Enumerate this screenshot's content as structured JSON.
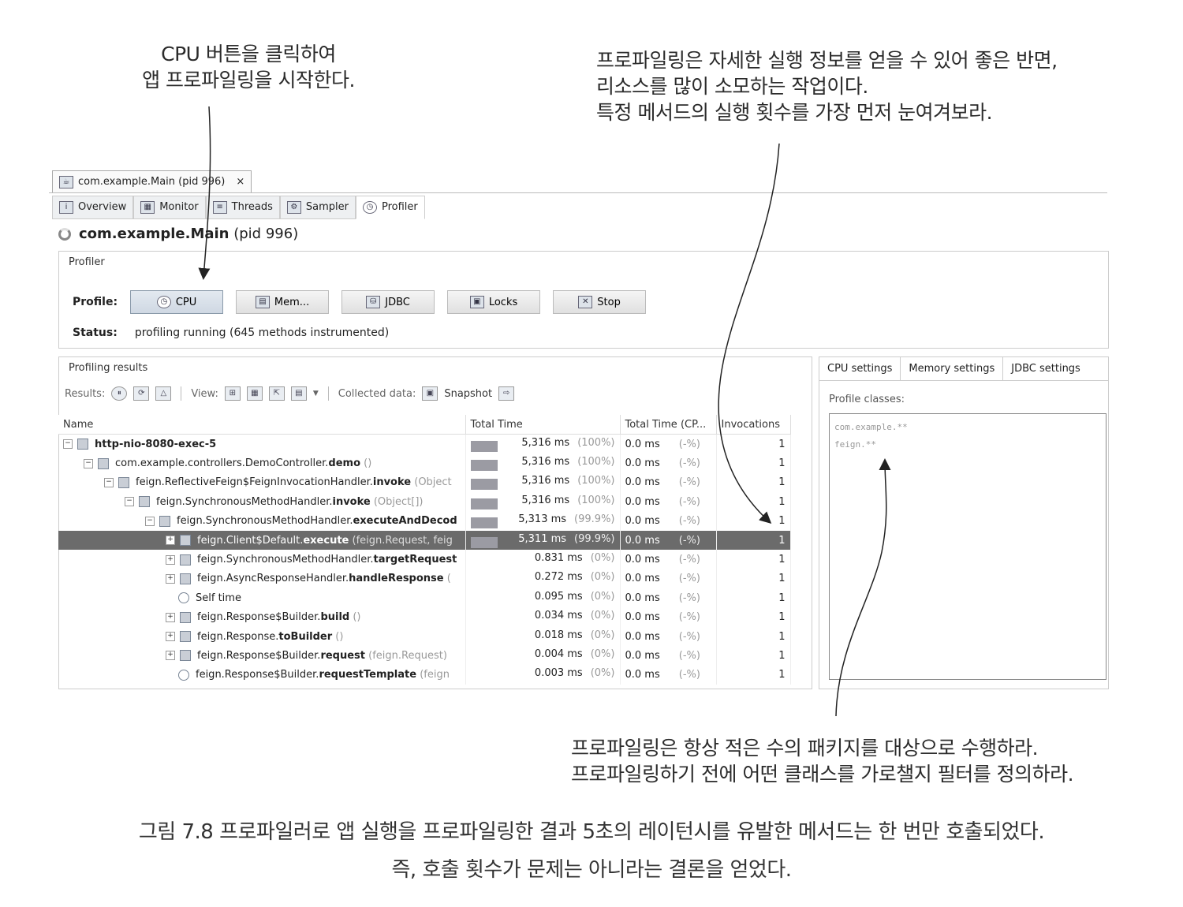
{
  "annotations": {
    "top_left": [
      "CPU 버튼을 클릭하여",
      "앱 프로파일링을 시작한다."
    ],
    "top_right": [
      "프로파일링은 자세한 실행 정보를 얻을 수 있어 좋은 반면,",
      "리소스를 많이 소모하는 작업이다.",
      "특정 메서드의 실행 횟수를 가장 먼저 눈여겨보라."
    ],
    "bottom_right": [
      "프로파일링은 항상 적은 수의 패키지를 대상으로 수행하라.",
      "프로파일링하기 전에 어떤 클래스를 가로챌지 필터를 정의하라."
    ]
  },
  "caption": [
    "그림 7.8 프로파일러로 앱 실행을 프로파일링한 결과 5초의 레이턴시를 유발한 메서드는 한 번만 호출되었다.",
    "즉, 호출 횟수가 문제는 아니라는 결론을 얻었다."
  ],
  "window_tab": {
    "label": "com.example.Main (pid 996)",
    "close": "×"
  },
  "subtabs": [
    "Overview",
    "Monitor",
    "Threads",
    "Sampler",
    "Profiler"
  ],
  "title": {
    "main": "com.example.Main",
    "pid": "(pid 996)"
  },
  "profiler": {
    "section_title": "Profiler",
    "profile_label": "Profile:",
    "buttons": [
      "CPU",
      "Mem...",
      "JDBC",
      "Locks",
      "Stop"
    ],
    "status_label": "Status:",
    "status_value": "profiling running (645 methods instrumented)"
  },
  "results": {
    "section_title": "Profiling results",
    "results_label": "Results:",
    "view_label": "View:",
    "collected_label": "Collected data:",
    "snapshot_label": "Snapshot",
    "columns": [
      "Name",
      "Total Time",
      "Total Time (CP...",
      "Invocations"
    ],
    "rows": [
      {
        "name": "http-nio-8080-exec-5",
        "method": "",
        "args": "",
        "total": "5,316 ms",
        "total_pct": "(100%)",
        "cpu": "0.0 ms",
        "cpu_pct": "(-%)",
        "inv": "1"
      },
      {
        "name": "com.example.controllers.DemoController.",
        "method": "demo",
        "args": " ()",
        "total": "5,316 ms",
        "total_pct": "(100%)",
        "cpu": "0.0 ms",
        "cpu_pct": "(-%)",
        "inv": "1"
      },
      {
        "name": "feign.ReflectiveFeign$FeignInvocationHandler.",
        "method": "invoke",
        "args": " (Object",
        "total": "5,316 ms",
        "total_pct": "(100%)",
        "cpu": "0.0 ms",
        "cpu_pct": "(-%)",
        "inv": "1"
      },
      {
        "name": "feign.SynchronousMethodHandler.",
        "method": "invoke",
        "args": " (Object[])",
        "total": "5,316 ms",
        "total_pct": "(100%)",
        "cpu": "0.0 ms",
        "cpu_pct": "(-%)",
        "inv": "1"
      },
      {
        "name": "feign.SynchronousMethodHandler.",
        "method": "executeAndDecod",
        "args": "",
        "total": "5,313 ms",
        "total_pct": "(99.9%)",
        "cpu": "0.0 ms",
        "cpu_pct": "(-%)",
        "inv": "1"
      },
      {
        "name": "feign.Client$Default.",
        "method": "execute",
        "args": " (feign.Request, feig",
        "total": "5,311 ms",
        "total_pct": "(99.9%)",
        "cpu": "0.0 ms",
        "cpu_pct": "(-%)",
        "inv": "1"
      },
      {
        "name": "feign.SynchronousMethodHandler.",
        "method": "targetRequest",
        "args": "",
        "total": "0.831 ms",
        "total_pct": "(0%)",
        "cpu": "0.0 ms",
        "cpu_pct": "(-%)",
        "inv": "1"
      },
      {
        "name": "feign.AsyncResponseHandler.",
        "method": "handleResponse",
        "args": " (",
        "total": "0.272 ms",
        "total_pct": "(0%)",
        "cpu": "0.0 ms",
        "cpu_pct": "(-%)",
        "inv": "1"
      },
      {
        "name": "Self time",
        "method": "",
        "args": "",
        "total": "0.095 ms",
        "total_pct": "(0%)",
        "cpu": "0.0 ms",
        "cpu_pct": "(-%)",
        "inv": "1"
      },
      {
        "name": "feign.Response$Builder.",
        "method": "build",
        "args": " ()",
        "total": "0.034 ms",
        "total_pct": "(0%)",
        "cpu": "0.0 ms",
        "cpu_pct": "(-%)",
        "inv": "1"
      },
      {
        "name": "feign.Response.",
        "method": "toBuilder",
        "args": " ()",
        "total": "0.018 ms",
        "total_pct": "(0%)",
        "cpu": "0.0 ms",
        "cpu_pct": "(-%)",
        "inv": "1"
      },
      {
        "name": "feign.Response$Builder.",
        "method": "request",
        "args": " (feign.Request)",
        "total": "0.004 ms",
        "total_pct": "(0%)",
        "cpu": "0.0 ms",
        "cpu_pct": "(-%)",
        "inv": "1"
      },
      {
        "name": "feign.Response$Builder.",
        "method": "requestTemplate",
        "args": " (feign",
        "total": "0.003 ms",
        "total_pct": "(0%)",
        "cpu": "0.0 ms",
        "cpu_pct": "(-%)",
        "inv": "1"
      }
    ]
  },
  "settings": {
    "tabs": [
      "CPU settings",
      "Memory settings",
      "JDBC settings"
    ],
    "profile_classes_label": "Profile classes:",
    "classes": [
      "com.example.**",
      "feign.**"
    ]
  }
}
